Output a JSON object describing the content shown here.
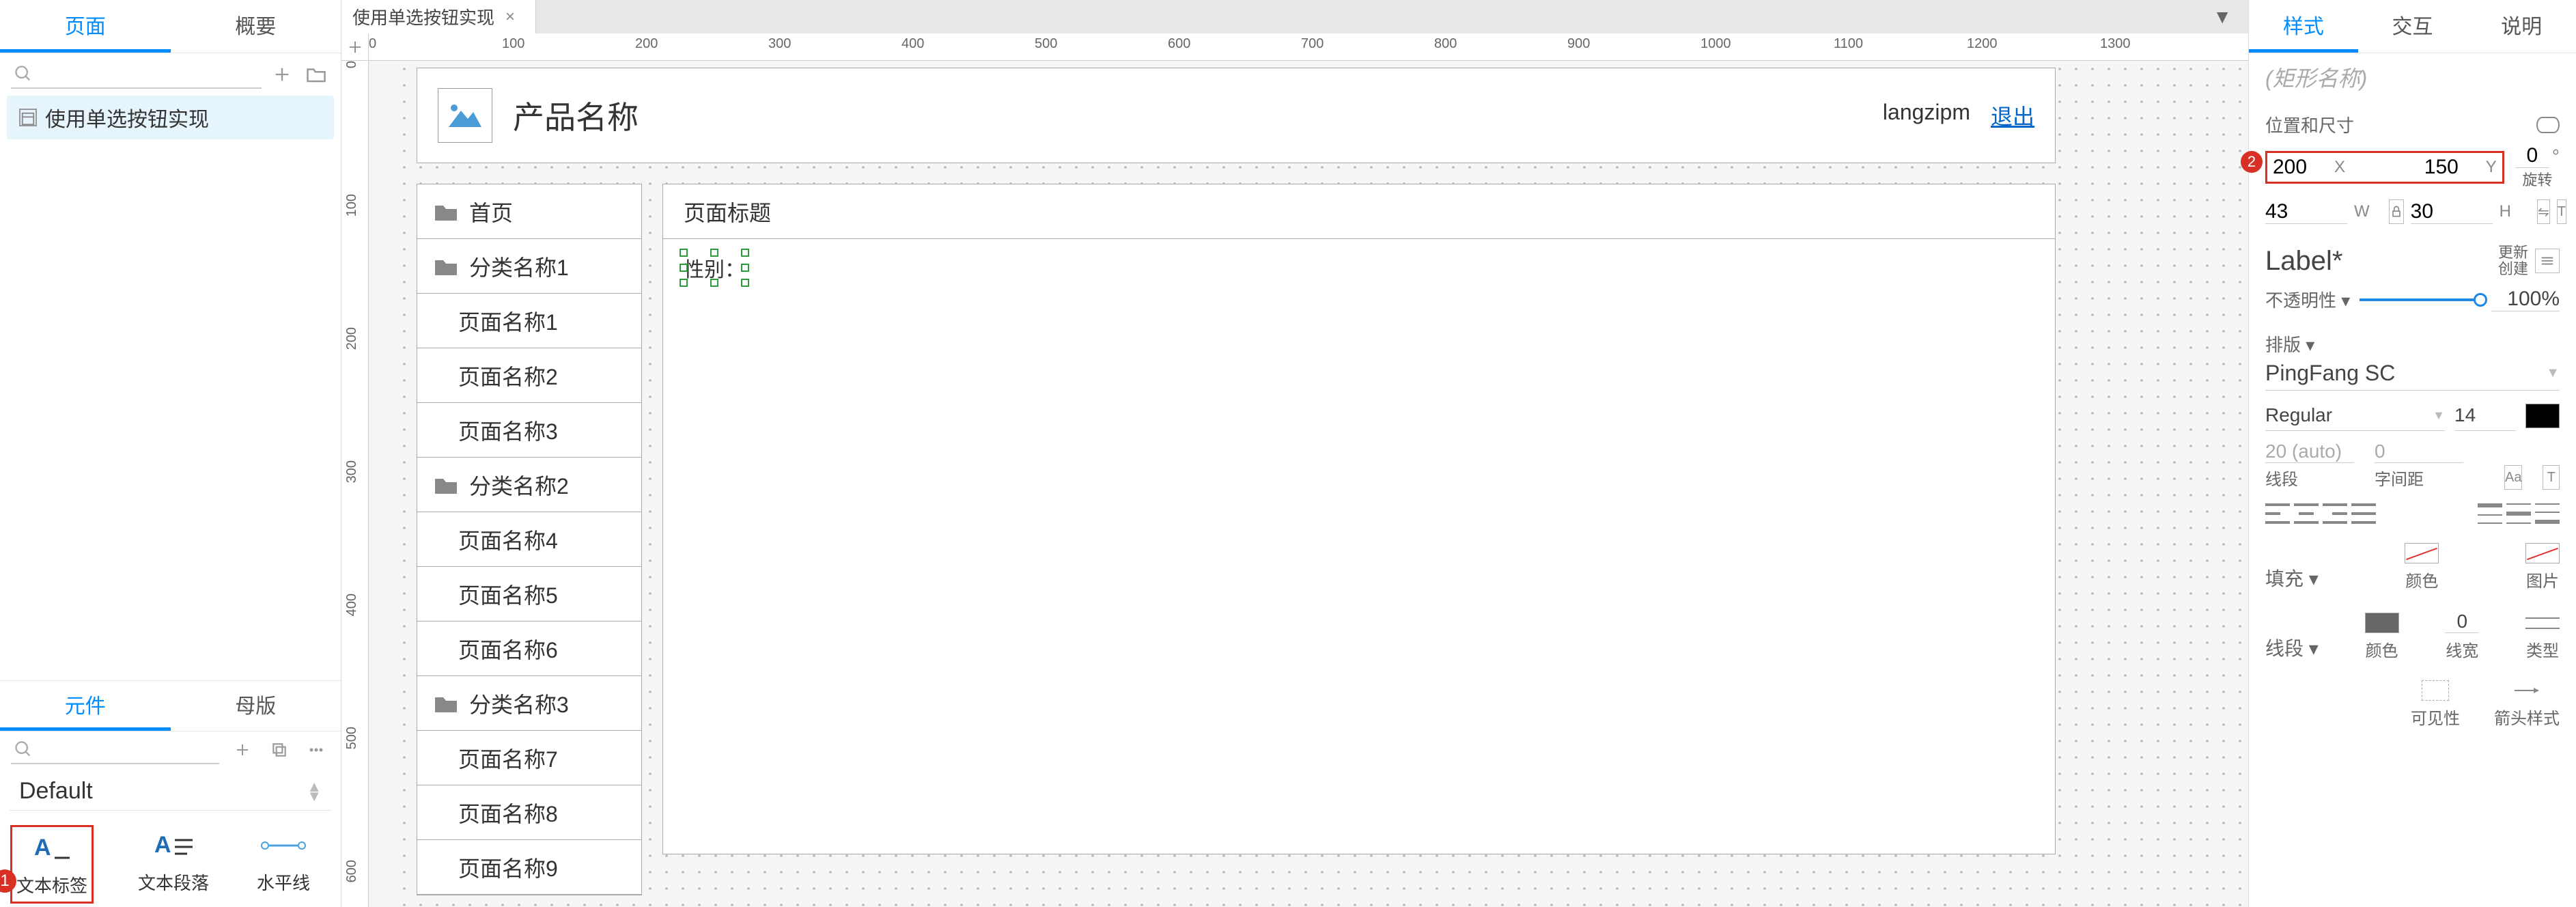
{
  "left": {
    "tabs": [
      "页面",
      "概要"
    ],
    "tree_item": "使用单选按钮实现",
    "tabs2": [
      "元件",
      "母版"
    ],
    "library": "Default",
    "widgets": [
      {
        "name": "文本标签"
      },
      {
        "name": "文本段落"
      },
      {
        "name": "水平线"
      }
    ],
    "badge1": "1"
  },
  "center": {
    "file_tab": "使用单选按钮实现",
    "ruler_h": [
      "0",
      "100",
      "200",
      "300",
      "400",
      "500",
      "600",
      "700",
      "800",
      "900",
      "1000",
      "1100",
      "1200",
      "1300"
    ],
    "ruler_v": [
      "0",
      "100",
      "200",
      "300",
      "400",
      "500",
      "600"
    ],
    "product_title": "产品名称",
    "user": "langzipm",
    "logout": "退出",
    "nav": {
      "home": "首页",
      "cats": [
        {
          "label": "分类名称1",
          "pages": [
            "页面名称1",
            "页面名称2",
            "页面名称3"
          ]
        },
        {
          "label": "分类名称2",
          "pages": [
            "页面名称4",
            "页面名称5",
            "页面名称6"
          ]
        },
        {
          "label": "分类名称3",
          "pages": [
            "页面名称7",
            "页面名称8",
            "页面名称9"
          ]
        }
      ]
    },
    "content_title": "页面标题",
    "selected_text": "性别："
  },
  "right": {
    "tabs": [
      "样式",
      "交互",
      "说明"
    ],
    "shape_name_placeholder": "(矩形名称)",
    "pos_label": "位置和尺寸",
    "x": "200",
    "y": "150",
    "rot": "0",
    "rot_label": "旋转",
    "w": "43",
    "h": "30",
    "badge2": "2",
    "label_name": "Label*",
    "update_create": "更新\n创建",
    "opacity_label": "不透明性 ▾",
    "opacity_val": "100%",
    "typo_label": "排版 ▾",
    "font": "PingFang SC",
    "weight": "Regular",
    "font_size": "14",
    "line_val": "20 (auto)",
    "line_lbl": "线段",
    "letter_val": "0",
    "letter_lbl": "字间距",
    "fill_label": "填充 ▾",
    "fill_cols": [
      "颜色",
      "图片"
    ],
    "line_label": "线段 ▾",
    "line_cols": [
      "颜色",
      "线宽",
      "类型"
    ],
    "line_width": "0",
    "extra_cols": [
      "可见性",
      "箭头样式"
    ]
  }
}
